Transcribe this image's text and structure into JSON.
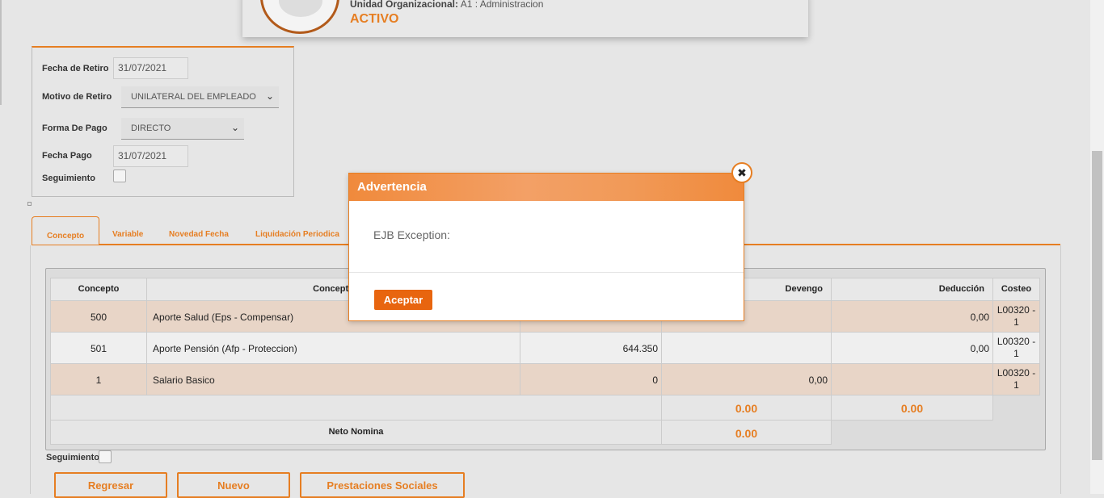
{
  "header": {
    "org_label": "Unidad Organizacional:",
    "org_value": "A1 : Administracion",
    "status": "ACTIVO"
  },
  "form": {
    "fecha_retiro_label": "Fecha de Retiro",
    "fecha_retiro_value": "31/07/2021",
    "motivo_label": "Motivo de Retiro",
    "motivo_value": "UNILATERAL DEL EMPLEADO",
    "forma_pago_label": "Forma De Pago",
    "forma_pago_value": "DIRECTO",
    "fecha_pago_label": "Fecha Pago",
    "fecha_pago_value": "31/07/2021",
    "seguimiento_label": "Seguimiento"
  },
  "tabs": [
    "Concepto",
    "Variable",
    "Novedad Fecha",
    "Liquidación Periodica"
  ],
  "table": {
    "headers": [
      "Concepto",
      "Concepto",
      "",
      "Devengo",
      "Deducción",
      "Costeo"
    ],
    "rows": [
      {
        "code": "500",
        "name": "Aporte Salud (Eps - Compensar)",
        "base": "",
        "devengo": "",
        "deduccion": "0,00",
        "costeo": "L00320 - 1"
      },
      {
        "code": "501",
        "name": "Aporte Pensión (Afp - Proteccion)",
        "base": "644.350",
        "devengo": "",
        "deduccion": "0,00",
        "costeo": "L00320 - 1"
      },
      {
        "code": "1",
        "name": "Salario Basico",
        "base": "0",
        "devengo": "0,00",
        "deduccion": "",
        "costeo": "L00320 - 1"
      }
    ],
    "total_devengo": "0.00",
    "total_deduccion": "0.00",
    "neto_label": "Neto Nomina",
    "neto_value": "0.00"
  },
  "seguimiento_bottom": "Seguimiento",
  "buttons": {
    "regresar": "Regresar",
    "nuevo": "Nuevo",
    "prestaciones": "Prestaciones Sociales"
  },
  "modal": {
    "title": "Advertencia",
    "message": "EJB Exception:",
    "ok": "Aceptar",
    "close_icon": "✖"
  }
}
